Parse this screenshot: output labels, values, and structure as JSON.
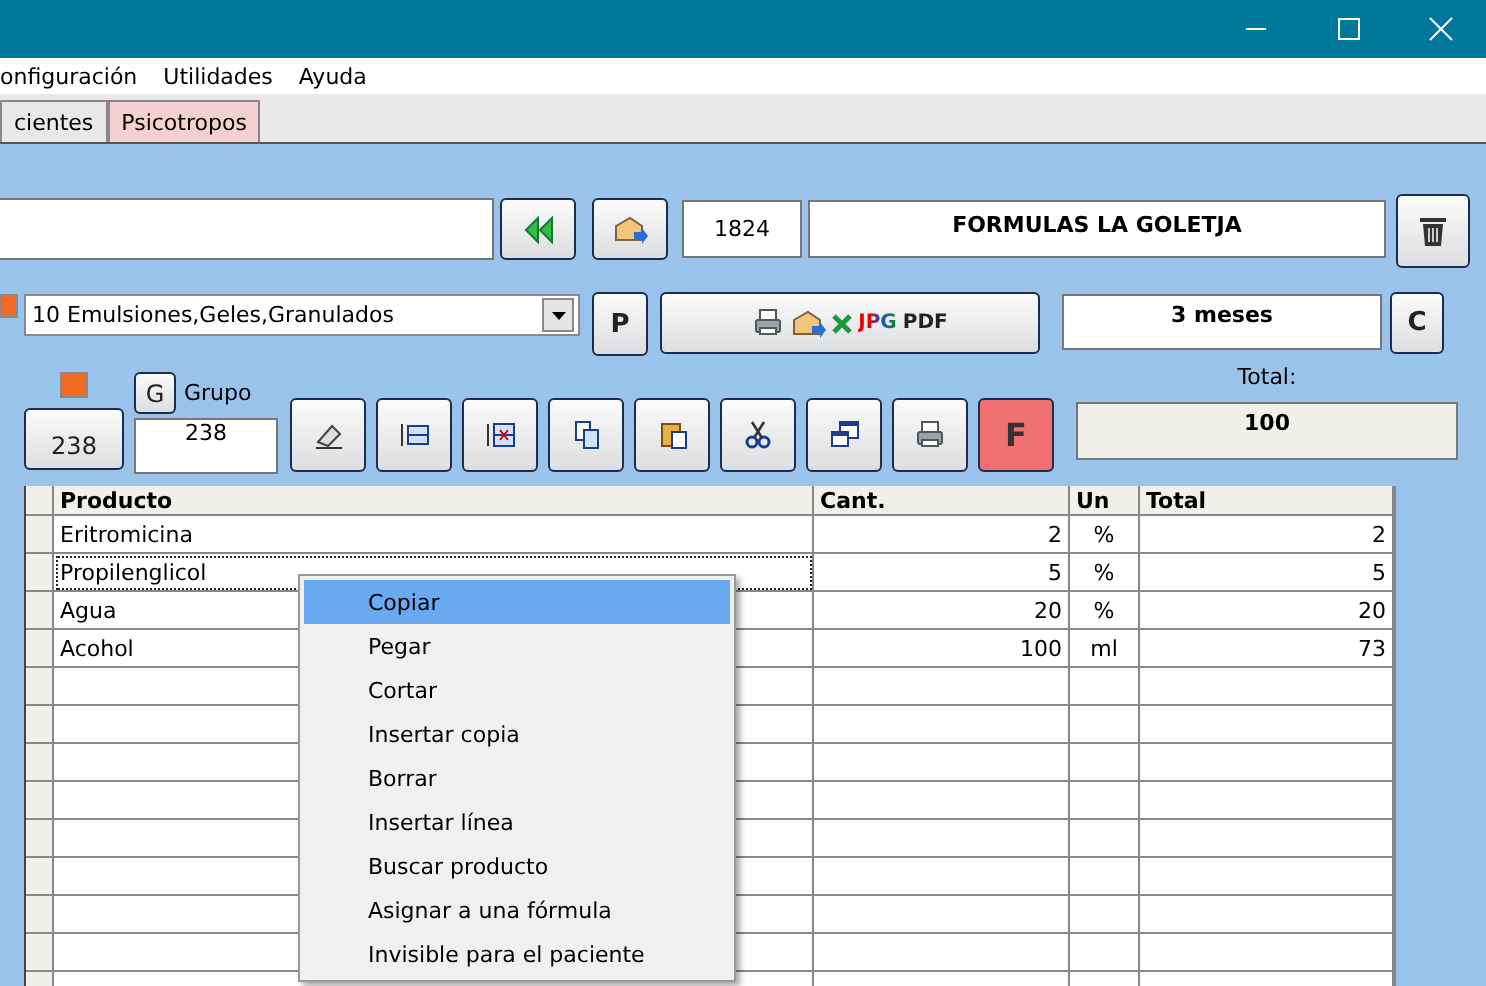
{
  "menu": [
    "onfiguración",
    "Utilidades",
    "Ayuda"
  ],
  "tabs": [
    {
      "label": "cientes",
      "selected": false
    },
    {
      "label": "Psicotropos",
      "selected": true
    }
  ],
  "record": {
    "number": "1824",
    "name": "FORMULAS LA GOLETJA"
  },
  "category": {
    "value": "10 Emulsiones,Geles,Granulados",
    "button": "P"
  },
  "export": {
    "labels": [
      "JPG",
      "PDF"
    ]
  },
  "duration": {
    "value": "3 meses",
    "button": "C"
  },
  "group": {
    "button": "G",
    "label": "Grupo",
    "count": "238",
    "value": "238"
  },
  "f_button": "F",
  "total": {
    "label": "Total:",
    "value": "100"
  },
  "table": {
    "columns": [
      "Producto",
      "Cant.",
      "Un",
      "Total"
    ],
    "rows": [
      {
        "cells": [
          "Eritromicina",
          "2",
          "%",
          "2"
        ],
        "focused": false
      },
      {
        "cells": [
          "Propilenglicol",
          "5",
          "%",
          "5"
        ],
        "focused": true
      },
      {
        "cells": [
          "Agua",
          "20",
          "%",
          "20"
        ],
        "focused": false
      },
      {
        "cells": [
          "Acohol",
          "100",
          "ml",
          "73"
        ],
        "focused": false
      }
    ]
  },
  "context_menu": {
    "items": [
      {
        "label": "Copiar",
        "selected": true
      },
      {
        "label": "Pegar",
        "selected": false
      },
      {
        "label": "Cortar",
        "selected": false
      },
      {
        "label": "Insertar copia",
        "selected": false
      },
      {
        "label": "Borrar",
        "selected": false
      },
      {
        "label": "Insertar línea",
        "selected": false
      },
      {
        "label": "Buscar producto",
        "selected": false
      },
      {
        "label": "Asignar a una fórmula",
        "selected": false
      },
      {
        "label": "Invisible para el paciente",
        "selected": false
      }
    ]
  }
}
